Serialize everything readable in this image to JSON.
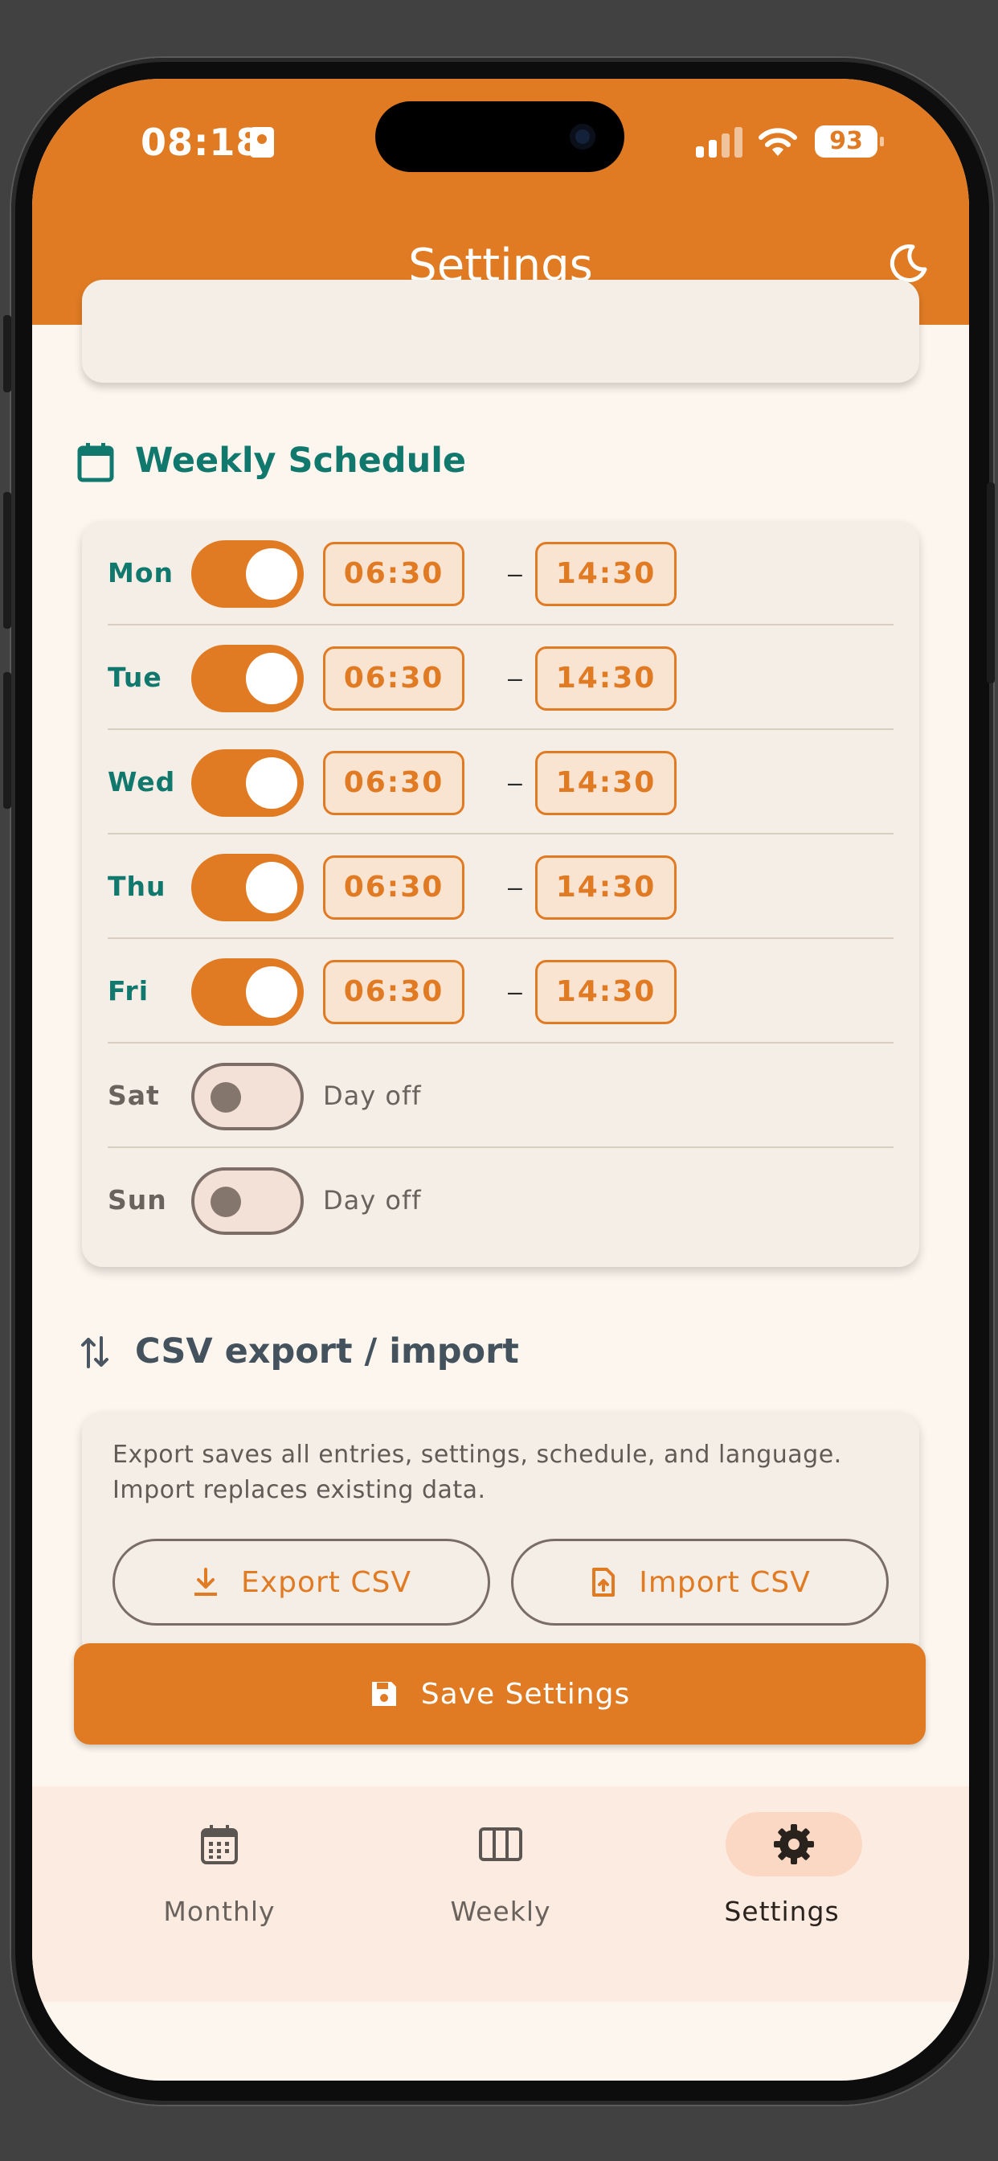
{
  "status_bar": {
    "time": "08:18",
    "battery": "93"
  },
  "header": {
    "title": "Settings",
    "theme_icon": "moon-icon"
  },
  "colors": {
    "accent": "#e07b24",
    "teal": "#11786e",
    "background": "#fdf6ee",
    "card": "#f4eee6"
  },
  "schedule": {
    "title": "Weekly Schedule",
    "separator": "–",
    "days": [
      {
        "label": "Mon",
        "enabled": true,
        "start": "06:30",
        "end": "14:30"
      },
      {
        "label": "Tue",
        "enabled": true,
        "start": "06:30",
        "end": "14:30"
      },
      {
        "label": "Wed",
        "enabled": true,
        "start": "06:30",
        "end": "14:30"
      },
      {
        "label": "Thu",
        "enabled": true,
        "start": "06:30",
        "end": "14:30"
      },
      {
        "label": "Fri",
        "enabled": true,
        "start": "06:30",
        "end": "14:30"
      },
      {
        "label": "Sat",
        "enabled": false,
        "off_text": "Day off"
      },
      {
        "label": "Sun",
        "enabled": false,
        "off_text": "Day off"
      }
    ]
  },
  "csv": {
    "title": "CSV export / import",
    "description_line1": "Export saves all entries, settings, schedule, and language.",
    "description_line2": "Import replaces existing data.",
    "export_label": "Export CSV",
    "import_label": "Import CSV"
  },
  "save_label": "Save Settings",
  "nav": {
    "items": [
      {
        "label": "Monthly",
        "icon": "calendar-grid-icon",
        "active": false
      },
      {
        "label": "Weekly",
        "icon": "columns-icon",
        "active": false
      },
      {
        "label": "Settings",
        "icon": "gear-icon",
        "active": true
      }
    ]
  }
}
